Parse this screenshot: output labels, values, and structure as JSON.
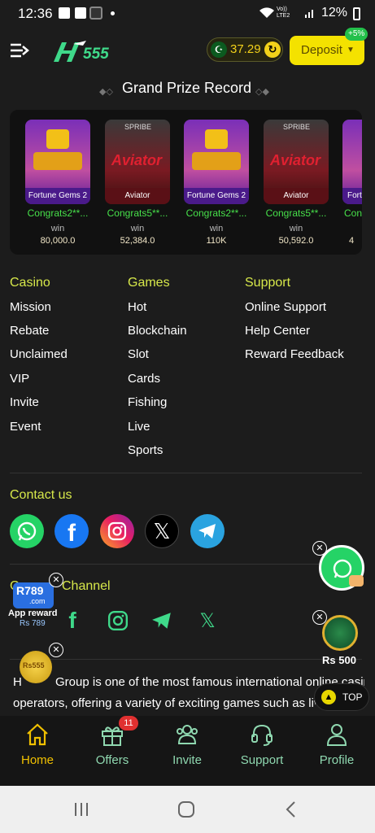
{
  "status": {
    "time": "12:36",
    "carrier": "Vo)) LTE2",
    "battery": "12%"
  },
  "header": {
    "logo": "H555",
    "balance": "37.29",
    "deposit_label": "Deposit",
    "deposit_bonus": "+5%"
  },
  "grand": {
    "title": "Grand Prize Record",
    "cards": [
      {
        "game": "Fortune Gems 2",
        "winner": "Congrats2**...",
        "label": "win",
        "amount": "80,000.0"
      },
      {
        "game": "Aviator",
        "winner": "Congrats5**...",
        "label": "win",
        "amount": "52,384.0"
      },
      {
        "game": "Fortune Gems 2",
        "winner": "Congrats2**...",
        "label": "win",
        "amount": "110K"
      },
      {
        "game": "Aviator",
        "winner": "Congrats5**...",
        "label": "win",
        "amount": "50,592.0"
      },
      {
        "game": "Fortu",
        "winner": "Con",
        "label": "",
        "amount": "4"
      }
    ]
  },
  "columns": {
    "casino": {
      "title": "Casino",
      "items": [
        "Mission",
        "Rebate",
        "Unclaimed",
        "VIP",
        "Invite",
        "Event"
      ]
    },
    "games": {
      "title": "Games",
      "items": [
        "Hot",
        "Blockchain",
        "Slot",
        "Cards",
        "Fishing",
        "Live",
        "Sports"
      ]
    },
    "support": {
      "title": "Support",
      "items": [
        "Online Support",
        "Help Center",
        "Reward Feedback"
      ]
    }
  },
  "contact": {
    "title": "Contact us"
  },
  "community": {
    "title": "Channel",
    "prefix": "C"
  },
  "about": {
    "line1": "H",
    "line1b": "Group is one of the most famous international online casino",
    "line2": "operators, offering a variety of exciting games such as liv"
  },
  "floating": {
    "r789_logo": "R789",
    "r789_sub": ".com",
    "r789_caption": "App reward",
    "r789_amount": "Rs 789",
    "wheel_amount": "Rs 500",
    "coin_label": "Rs555",
    "top_label": "TOP"
  },
  "tabs": [
    {
      "label": "Home",
      "icon": "home-icon"
    },
    {
      "label": "Offers",
      "icon": "gift-icon",
      "badge": "11"
    },
    {
      "label": "Invite",
      "icon": "invite-icon"
    },
    {
      "label": "Support",
      "icon": "headset-icon"
    },
    {
      "label": "Profile",
      "icon": "profile-icon"
    }
  ],
  "colors": {
    "accent": "#d7e84a",
    "deposit": "#f4e200",
    "win": "#47e04a",
    "tab_active": "#f0c000",
    "tab": "#8fd8b0"
  }
}
